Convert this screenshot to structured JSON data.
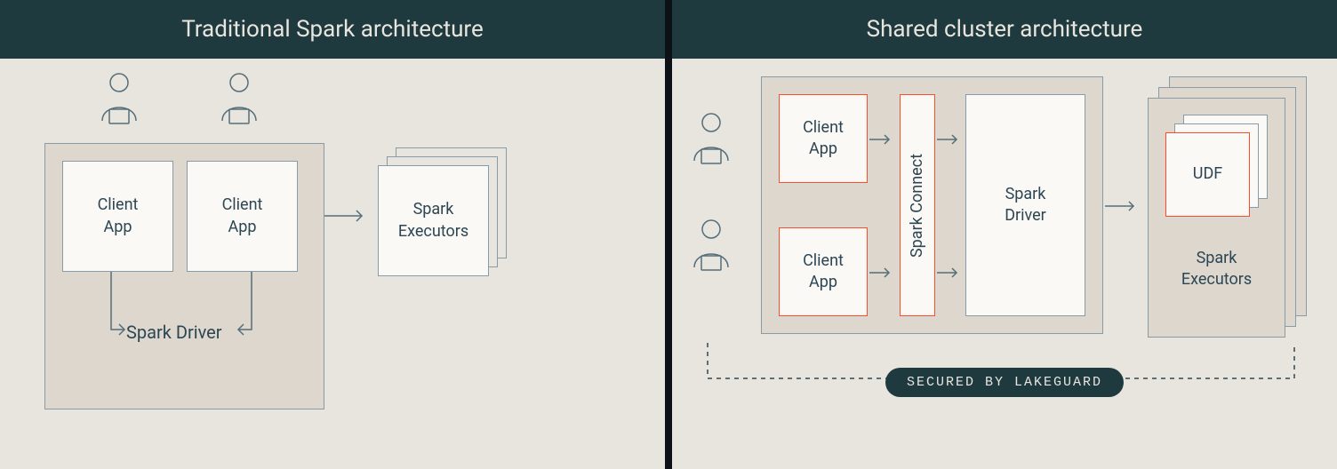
{
  "left": {
    "title": "Traditional Spark architecture",
    "client_app_1": "Client\nApp",
    "client_app_2": "Client\nApp",
    "spark_driver": "Spark Driver",
    "spark_executors": "Spark\nExecutors"
  },
  "right": {
    "title": "Shared cluster architecture",
    "client_app_1": "Client\nApp",
    "client_app_2": "Client\nApp",
    "spark_connect": "Spark Connect",
    "spark_driver": "Spark\nDriver",
    "udf": "UDF",
    "spark_executors": "Spark\nExecutors",
    "secured_badge": "SECURED BY LAKEGUARD"
  },
  "colors": {
    "header_bg": "#1e3a3f",
    "panel_bg": "#e8e4de",
    "container_bg": "#ddd7cd",
    "box_bg": "#fbf9f5",
    "line": "#546e7a",
    "red": "#ff4b2b",
    "text": "#2d4654"
  }
}
